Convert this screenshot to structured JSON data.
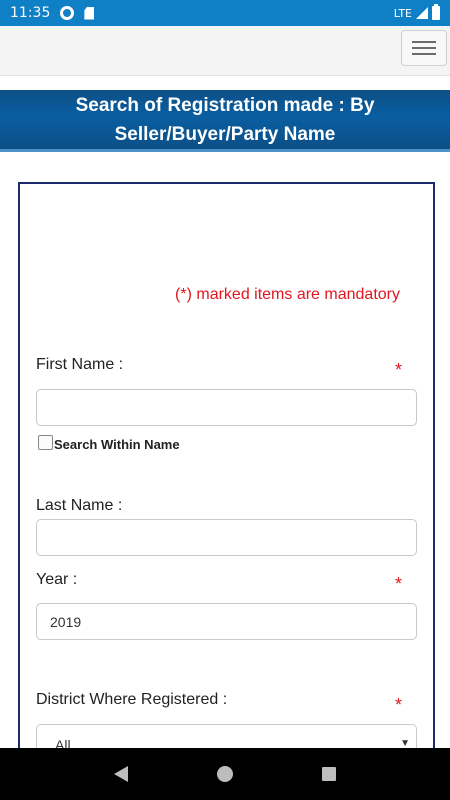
{
  "status_bar": {
    "time": "11:35",
    "network": "LTE",
    "icons": [
      "settings-icon",
      "sd-card-icon",
      "signal-icon",
      "battery-icon"
    ]
  },
  "header": {
    "menu_icon": "hamburger-menu-icon"
  },
  "page": {
    "title": "Search of Registration made : By Seller/Buyer/Party Name"
  },
  "form": {
    "mandatory_note": "(*) marked items are mandatory",
    "required_marker": "*",
    "first_name": {
      "label": "First Name :",
      "value": "",
      "required": true
    },
    "search_within": {
      "label": "Search Within Name",
      "checked": false
    },
    "last_name": {
      "label": "Last Name :",
      "value": ""
    },
    "year": {
      "label": "Year :",
      "value": "2019",
      "required": true
    },
    "district": {
      "label": "District Where Registered :",
      "selected": "All",
      "required": true
    }
  },
  "colors": {
    "status_bar": "#0f7fc6",
    "title_band": "#0a5ea1",
    "required": "#e0171f",
    "card_border": "#1b2b6c"
  }
}
